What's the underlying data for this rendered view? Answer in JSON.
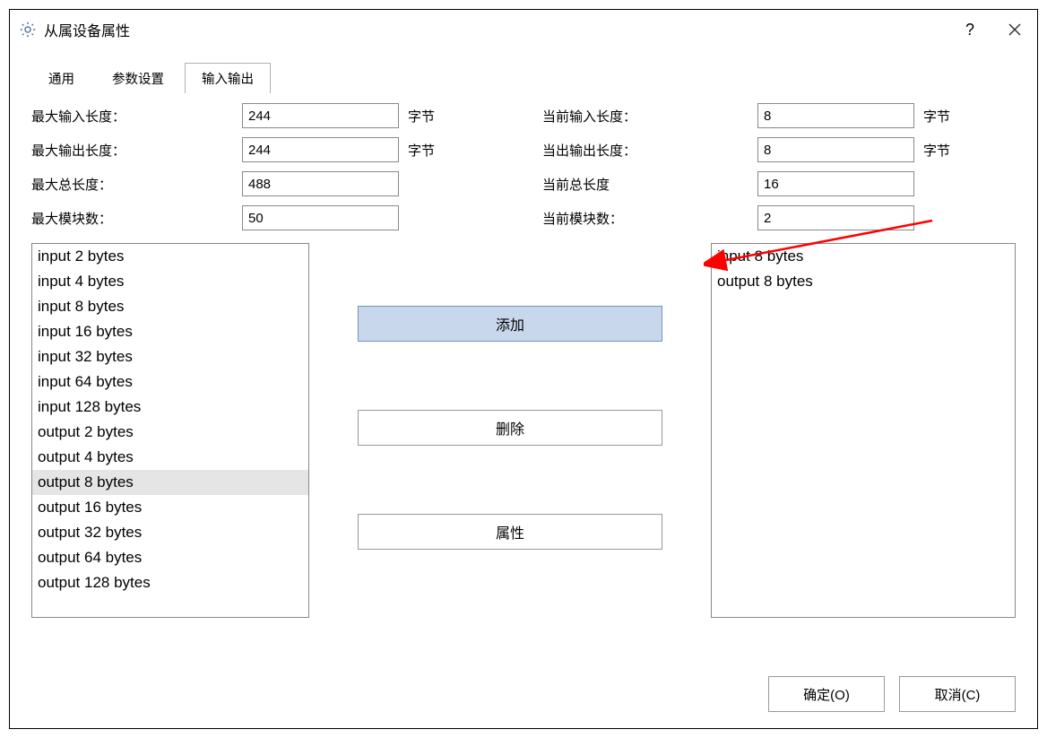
{
  "window": {
    "title": "从属设备属性",
    "help": "?",
    "close": "×"
  },
  "tabs": {
    "items": [
      "通用",
      "参数设置",
      "输入输出"
    ],
    "active_index": 2
  },
  "fields": {
    "left": [
      {
        "label": "最大输入长度：",
        "value": "244",
        "unit": "字节"
      },
      {
        "label": "最大输出长度：",
        "value": "244",
        "unit": "字节"
      },
      {
        "label": "最大总长度：",
        "value": "488",
        "unit": ""
      },
      {
        "label": "最大模块数：",
        "value": "50",
        "unit": ""
      }
    ],
    "right": [
      {
        "label": "当前输入长度：",
        "value": "8",
        "unit": "字节"
      },
      {
        "label": "当出输出长度：",
        "value": "8",
        "unit": "字节"
      },
      {
        "label": "当前总长度",
        "value": "16",
        "unit": ""
      },
      {
        "label": "当前模块数：",
        "value": "2",
        "unit": ""
      }
    ]
  },
  "available_modules": [
    "input 2 bytes",
    "input 4 bytes",
    "input 8 bytes",
    "input 16 bytes",
    "input 32 bytes",
    "input 64 bytes",
    "input 128 bytes",
    "output 2 bytes",
    "output 4 bytes",
    "output 8 bytes",
    "output 16 bytes",
    "output 32 bytes",
    "output 64 bytes",
    "output 128 bytes"
  ],
  "available_selected_index": 9,
  "selected_modules": [
    "input 8 bytes",
    "output 8 bytes"
  ],
  "buttons": {
    "add": "添加",
    "delete": "删除",
    "props": "属性",
    "ok": "确定(O)",
    "cancel": "取消(C)"
  },
  "annotation": {
    "arrow_color": "#ff0000"
  }
}
